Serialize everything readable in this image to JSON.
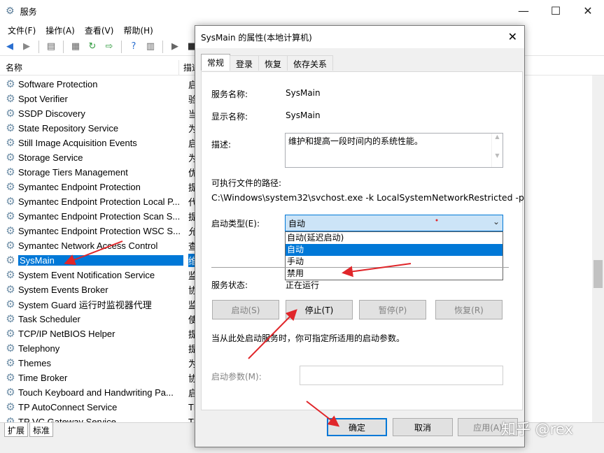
{
  "window": {
    "title": "服务",
    "minimize": "—",
    "maximize": "☐",
    "close": "✕"
  },
  "menu": [
    "文件(F)",
    "操作(A)",
    "查看(V)",
    "帮助(H)"
  ],
  "columns": {
    "name": "名称",
    "desc": "描述"
  },
  "services": [
    {
      "name": "Software Protection",
      "desc": "启用"
    },
    {
      "name": "Spot Verifier",
      "desc": "验证"
    },
    {
      "name": "SSDP Discovery",
      "desc": "当发"
    },
    {
      "name": "State Repository Service",
      "desc": "为应"
    },
    {
      "name": "Still Image Acquisition Events",
      "desc": "启动"
    },
    {
      "name": "Storage Service",
      "desc": "为存"
    },
    {
      "name": "Storage Tiers Management",
      "desc": "优化"
    },
    {
      "name": "Symantec Endpoint Protection",
      "desc": "提供"
    },
    {
      "name": "Symantec Endpoint Protection Local P...",
      "desc": "代表"
    },
    {
      "name": "Symantec Endpoint Protection Scan S...",
      "desc": "提供"
    },
    {
      "name": "Symantec Endpoint Protection WSC S...",
      "desc": "允许"
    },
    {
      "name": "Symantec Network Access Control",
      "desc": "查找"
    },
    {
      "name": "SysMain",
      "desc": "维护"
    },
    {
      "name": "System Event Notification Service",
      "desc": "监视"
    },
    {
      "name": "System Events Broker",
      "desc": "协调"
    },
    {
      "name": "System Guard 运行时监视器代理",
      "desc": "监视"
    },
    {
      "name": "Task Scheduler",
      "desc": "使用"
    },
    {
      "name": "TCP/IP NetBIOS Helper",
      "desc": "提供"
    },
    {
      "name": "Telephony",
      "desc": "提供"
    },
    {
      "name": "Themes",
      "desc": "为用"
    },
    {
      "name": "Time Broker",
      "desc": "协调"
    },
    {
      "name": "Touch Keyboard and Handwriting Pa...",
      "desc": "启用"
    },
    {
      "name": "TP AutoConnect Service",
      "desc": "Thi"
    },
    {
      "name": "TP VC Gateway Service",
      "desc": "Thi"
    }
  ],
  "selected_index": 12,
  "bottom_tabs": [
    "扩展",
    "标准"
  ],
  "dialog": {
    "title": "SysMain 的属性(本地计算机)",
    "close": "✕",
    "tabs": [
      "常规",
      "登录",
      "恢复",
      "依存关系"
    ],
    "service_name_label": "服务名称:",
    "service_name": "SysMain",
    "display_name_label": "显示名称:",
    "display_name": "SysMain",
    "description_label": "描述:",
    "description": "维护和提高一段时间内的系统性能。",
    "path_label": "可执行文件的路径:",
    "path": "C:\\Windows\\system32\\svchost.exe -k LocalSystemNetworkRestricted -p",
    "startup_label": "启动类型(E):",
    "startup_value": "自动",
    "startup_options": [
      "自动(延迟启动)",
      "自动",
      "手动",
      "禁用"
    ],
    "status_label": "服务状态:",
    "status_value": "正在运行",
    "btn_start": "启动(S)",
    "btn_stop": "停止(T)",
    "btn_pause": "暂停(P)",
    "btn_resume": "恢复(R)",
    "hint": "当从此处启动服务时，你可指定所适用的启动参数。",
    "param_label": "启动参数(M):",
    "param_value": "",
    "ok": "确定",
    "cancel": "取消",
    "apply": "应用(A)"
  },
  "watermark": "知乎 @rex",
  "colors": {
    "selection": "#0078d7",
    "annotation": "#e0262a"
  }
}
